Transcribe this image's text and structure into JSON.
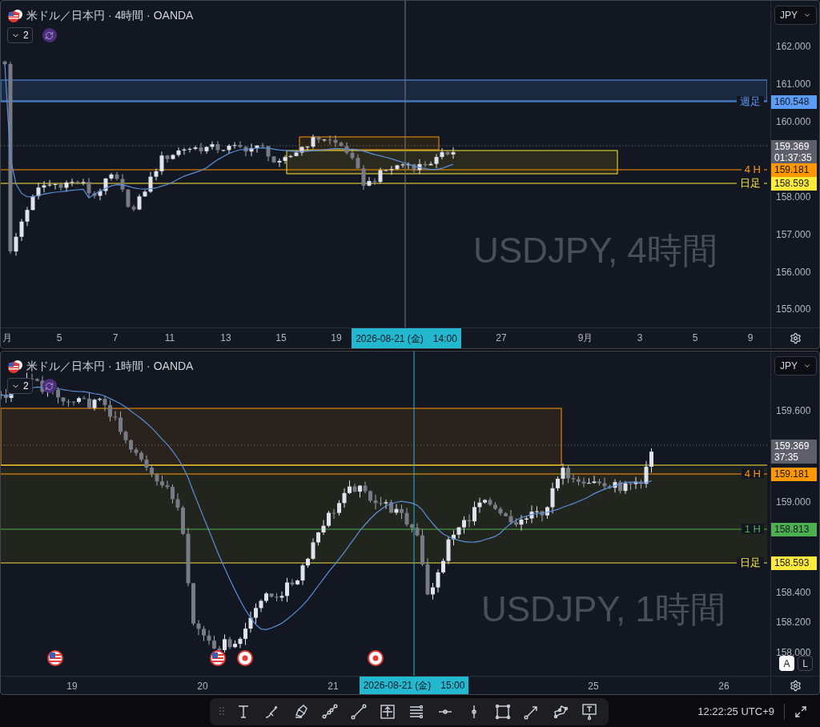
{
  "panes": [
    {
      "title": "米ドル／日本円 · 4時間 · OANDA",
      "indicator_count": "2",
      "watermark": "USDJPY, 4時間",
      "currency": "JPY",
      "price_ticks": [
        "162.000",
        "161.000",
        "160.000",
        "158.000",
        "157.000",
        "156.000",
        "155.000"
      ],
      "levels": [
        {
          "label": "週足",
          "price": "160.548",
          "color": "#5b9cf6"
        },
        {
          "label": "4 H",
          "price": "159.181",
          "color": "#ff9800"
        },
        {
          "label": "日足",
          "price": "158.593",
          "color": "#ffeb3b"
        }
      ],
      "last_price": {
        "price": "159.369",
        "countdown": "01:37:35"
      },
      "time_ticks": [
        "月",
        "5",
        "7",
        "11",
        "13",
        "15",
        "19",
        "27",
        "9月",
        "3",
        "5",
        "9"
      ],
      "crosshair": {
        "date": "2026-08-21 (金)",
        "time": "14:00"
      }
    },
    {
      "title": "米ドル／日本円 · 1時間 · OANDA",
      "indicator_count": "2",
      "watermark": "USDJPY, 1時間",
      "currency": "JPY",
      "price_ticks": [
        "159.600",
        "159.000",
        "158.400",
        "158.200",
        "158.000"
      ],
      "levels": [
        {
          "label": "4 H",
          "price": "159.181",
          "color": "#ff9800"
        },
        {
          "label": "1 H",
          "price": "158.813",
          "color": "#4caf50"
        },
        {
          "label": "日足",
          "price": "158.593",
          "color": "#ffeb3b"
        }
      ],
      "last_price": {
        "price": "159.369",
        "countdown": "37:35"
      },
      "time_ticks": [
        "19",
        "20",
        "21",
        "25",
        "26"
      ],
      "crosshair": {
        "date": "2026-08-21 (金)",
        "time": "15:00"
      },
      "events": [
        {
          "kind": "us"
        },
        {
          "kind": "us"
        },
        {
          "kind": "jp"
        },
        {
          "kind": "jp"
        }
      ],
      "scale_buttons": [
        {
          "label": "A",
          "selected": true
        },
        {
          "label": "L",
          "selected": false
        }
      ]
    }
  ],
  "toolbar": {
    "clock": "12:22:25 UTC+9"
  }
}
